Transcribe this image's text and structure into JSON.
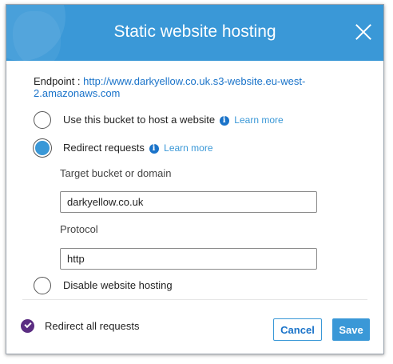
{
  "dialog": {
    "title": "Static website hosting",
    "close_icon": "close-icon"
  },
  "endpoint": {
    "label": "Endpoint : ",
    "url": "http://www.darkyellow.co.uk.s3-website.eu-west-2.amazonaws.com"
  },
  "options": {
    "host": {
      "label": "Use this bucket to host a website",
      "learn_more": "Learn more",
      "selected": false
    },
    "redirect": {
      "label": "Redirect requests",
      "learn_more": "Learn more",
      "selected": true
    },
    "disable": {
      "label": "Disable website hosting",
      "selected": false
    }
  },
  "redirect_form": {
    "target_label": "Target bucket or domain",
    "target_value": "darkyellow.co.uk",
    "protocol_label": "Protocol",
    "protocol_value": "http"
  },
  "footer": {
    "checkbox_label": "Redirect all requests",
    "checkbox_checked": true,
    "cancel_label": "Cancel",
    "save_label": "Save"
  },
  "colors": {
    "header": "#3a98d7",
    "link": "#1a73c9",
    "check": "#5b2d82"
  },
  "icons": {
    "info": "info-icon",
    "close": "close-icon",
    "check": "check-icon"
  }
}
